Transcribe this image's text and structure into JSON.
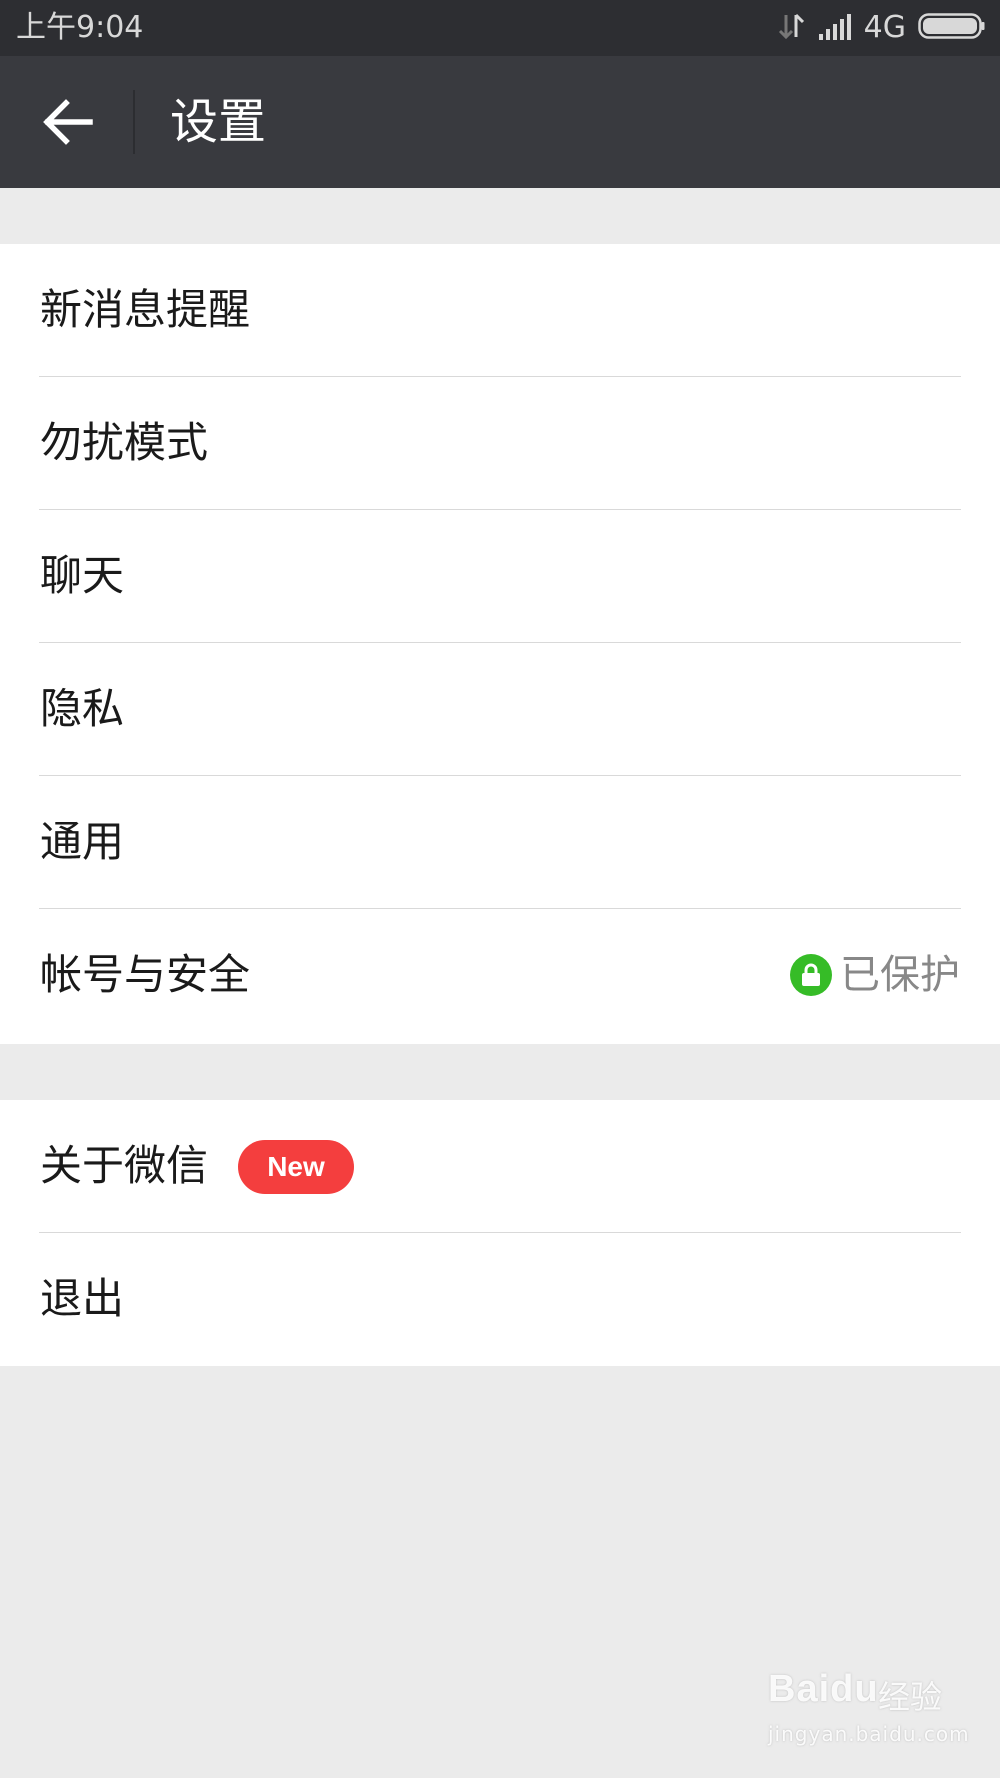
{
  "status_bar": {
    "time": "上午9:04",
    "network": "4G",
    "icons": [
      "data-transfer-icon",
      "signal-icon",
      "battery-icon"
    ]
  },
  "header": {
    "title": "设置",
    "back_icon": "arrow-left-icon"
  },
  "settings": {
    "group1": [
      {
        "label": "新消息提醒"
      },
      {
        "label": "勿扰模式"
      },
      {
        "label": "聊天"
      },
      {
        "label": "隐私"
      },
      {
        "label": "通用"
      },
      {
        "label": "帐号与安全",
        "status": "已保护",
        "status_icon": "lock-icon"
      }
    ],
    "group2": [
      {
        "label": "关于微信",
        "badge": "New"
      },
      {
        "label": "退出"
      }
    ]
  },
  "watermark": {
    "logo": "Baidu",
    "product": "经验",
    "url": "jingyan.baidu.com"
  },
  "colors": {
    "status_bar_bg": "#2d2e32",
    "header_bg": "#393a3f",
    "page_bg": "#ebebeb",
    "protected_green": "#36bc27",
    "badge_red": "#f43e3e"
  }
}
